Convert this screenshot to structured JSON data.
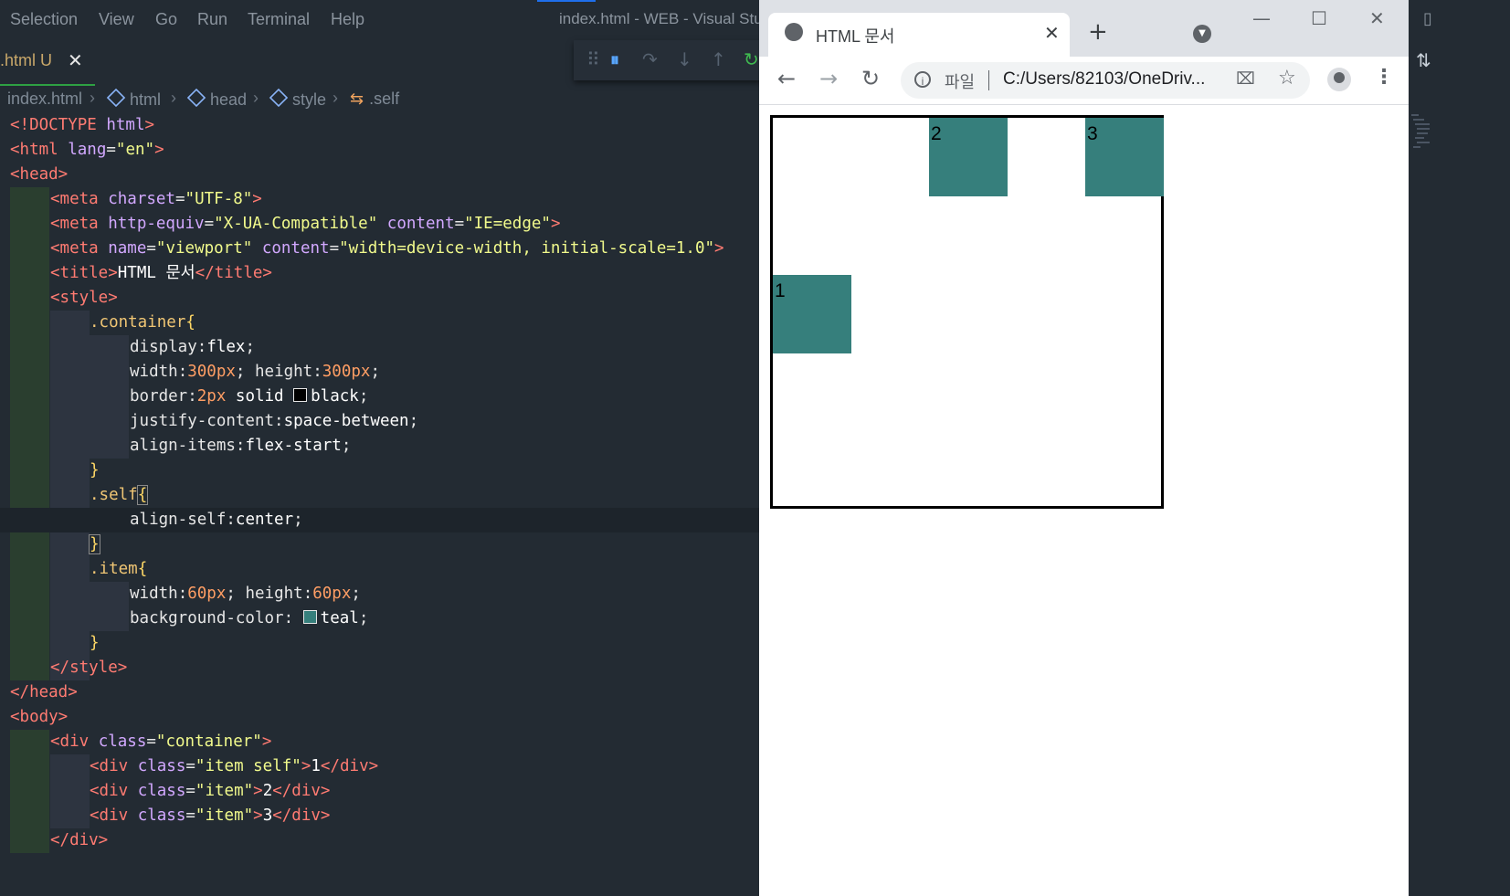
{
  "menubar": {
    "items": [
      "Selection",
      "View",
      "Go",
      "Run",
      "Terminal",
      "Help"
    ],
    "window_title": "index.html - WEB - Visual Stu"
  },
  "editor_tab": {
    "label": ".html U",
    "close": "✕"
  },
  "breadcrumb": {
    "items": [
      "index.html",
      "html",
      "head",
      "style",
      ".self"
    ]
  },
  "code_lines": [
    "<!DOCTYPE html>",
    "<html lang=\"en\">",
    "<head>",
    "<meta charset=\"UTF-8\">",
    "<meta http-equiv=\"X-UA-Compatible\" content=\"IE=edge\">",
    "<meta name=\"viewport\" content=\"width=device-width, initial-scale=1.0\">",
    "<title>HTML 문서</title>",
    "<style>",
    ".container{",
    "display:flex;",
    "width:300px; height:300px;",
    "border:2px solid black;",
    "justify-content:space-between;",
    "align-items:flex-start;",
    "}",
    ".self{",
    "align-self:center;",
    "}",
    ".item{",
    "width:60px; height:60px;",
    "background-color: teal;",
    "}",
    "</style>",
    "</head>",
    "<body>",
    "<div class=\"container\">",
    "<div class=\"item self\">1</div>",
    "<div class=\"item\">2</div>",
    "<div class=\"item\">3</div>",
    "</div>"
  ],
  "browser": {
    "tab_title": "HTML 문서",
    "scheme_label": "파일",
    "url": "C:/Users/82103/OneDriv...",
    "items": [
      "1",
      "2",
      "3"
    ]
  },
  "colors": {
    "item_fill": "#367f7c",
    "editor_bg": "#232b33",
    "container_border": "#000000"
  }
}
